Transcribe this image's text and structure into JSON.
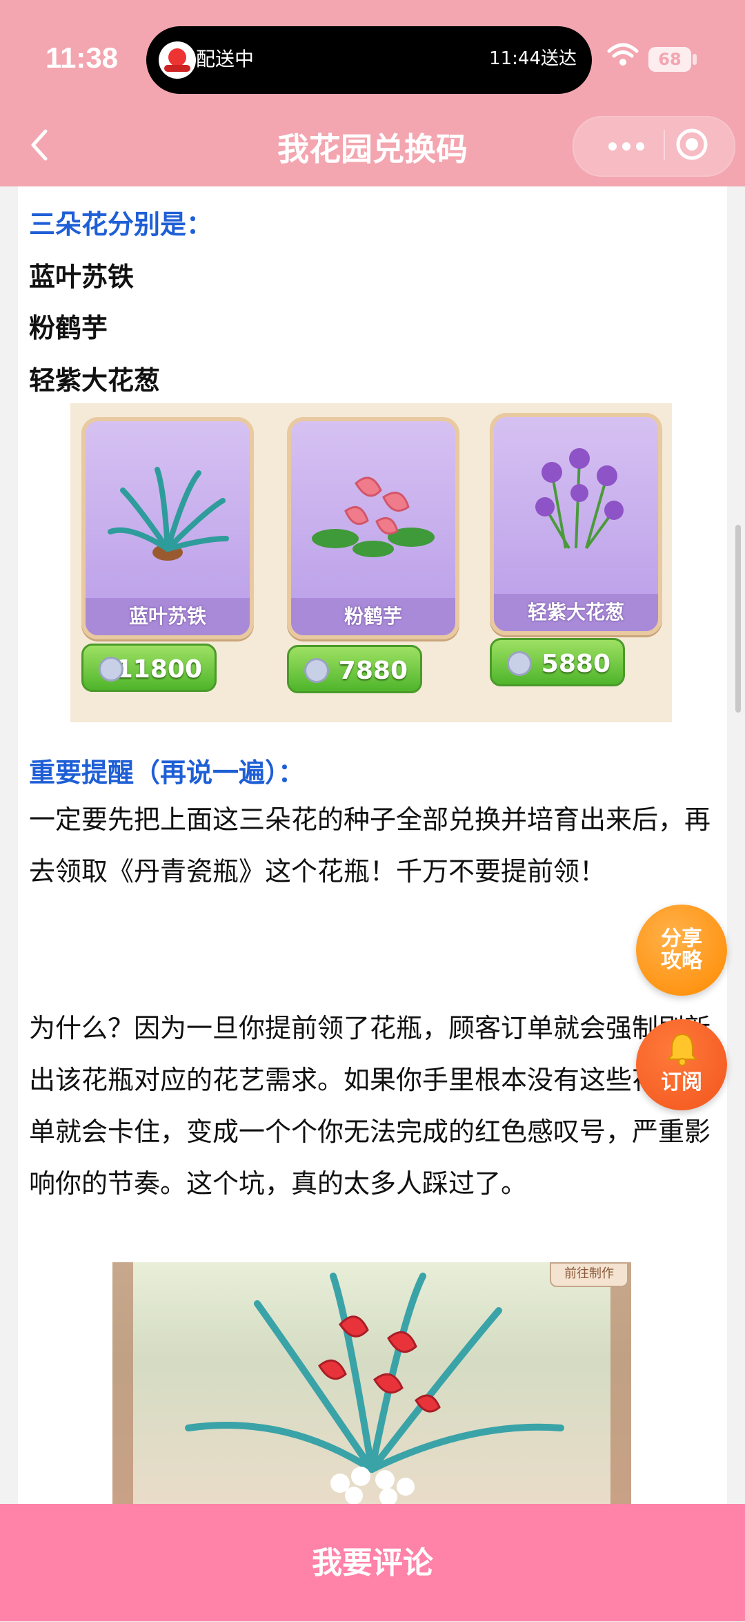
{
  "status_bar": {
    "time": "11:38",
    "live_activity_left": "配送中",
    "live_activity_right": "11:44送达",
    "battery": "68"
  },
  "nav": {
    "title": "我花园兑换码"
  },
  "content": {
    "heading_flowers": "三朵花分别是：",
    "flowers": [
      "蓝叶苏铁",
      "粉鹤芋",
      "轻紫大花葱"
    ],
    "cards": [
      {
        "label": "蓝叶苏铁",
        "price": "11800"
      },
      {
        "label": "粉鹤芋",
        "price": "7880"
      },
      {
        "label": "轻紫大花葱",
        "price": "5880"
      }
    ],
    "heading_reminder": "重要提醒（再说一遍）：",
    "paragraph_1": "一定要先把上面这三朵花的种子全部兑换并培育出来后，再去领取《丹青瓷瓶》这个花瓶！千万不要提前领！",
    "paragraph_2": "为什么？因为一旦你提前领了花瓶，顾客订单就会强制刷新出该花瓶对应的花艺需求。如果你手里根本没有这些花，订单就会卡住，变成一个个你无法完成的红色感叹号，严重影响你的节奏。这个坑，真的太多人踩过了。",
    "photo_tag": "前往制作"
  },
  "floating": {
    "share_line1": "分享",
    "share_line2": "攻略",
    "subscribe": "订阅"
  },
  "bottom": {
    "comment_label": "我要评论"
  },
  "colors": {
    "header": "#f3a6b0",
    "accent_blue": "#1f5fd6",
    "bottom_bar": "#ff82a8"
  }
}
